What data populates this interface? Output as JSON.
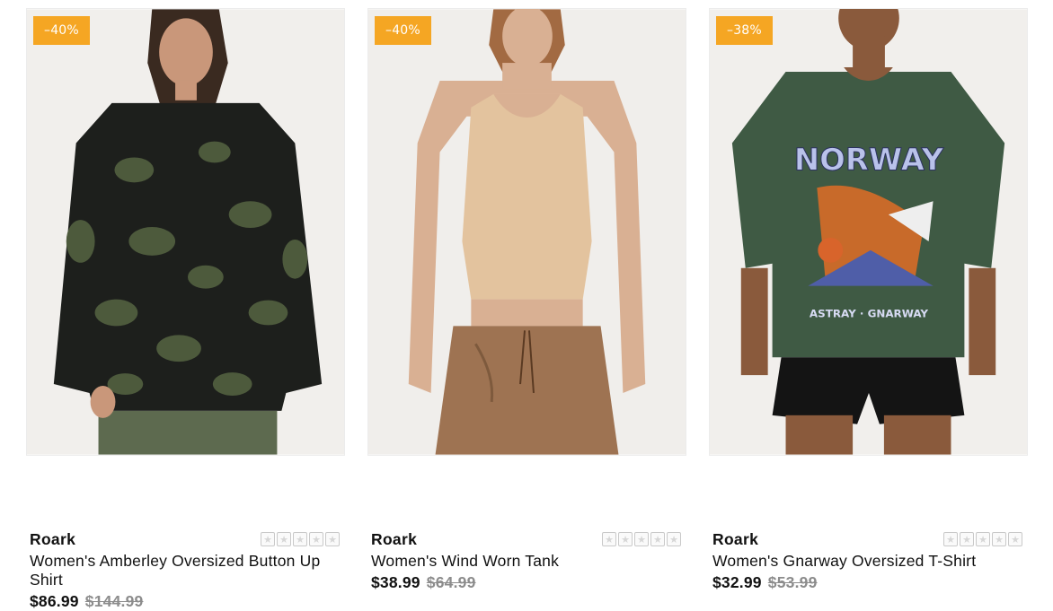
{
  "products": [
    {
      "badge": "–40%",
      "brand": "Roark",
      "title": "Women's Amberley Oversized Button Up Shirt",
      "price": "$86.99",
      "was_price": "$144.99",
      "rating_stars": 5
    },
    {
      "badge": "–40%",
      "brand": "Roark",
      "title": "Women's Wind Worn Tank",
      "price": "$38.99",
      "was_price": "$64.99",
      "rating_stars": 5
    },
    {
      "badge": "–38%",
      "brand": "Roark",
      "title": "Women's Gnarway Oversized T-Shirt",
      "price": "$32.99",
      "was_price": "$53.99",
      "rating_stars": 5
    }
  ],
  "graphic_text": "NORWAY",
  "graphic_subtext": "ASTRAY · GNARWAY",
  "colors": {
    "badge": "#f5a623",
    "was_price": "#8c8c8c",
    "star_empty": "#d6d6d6"
  },
  "icons": {
    "star": "star-icon"
  }
}
